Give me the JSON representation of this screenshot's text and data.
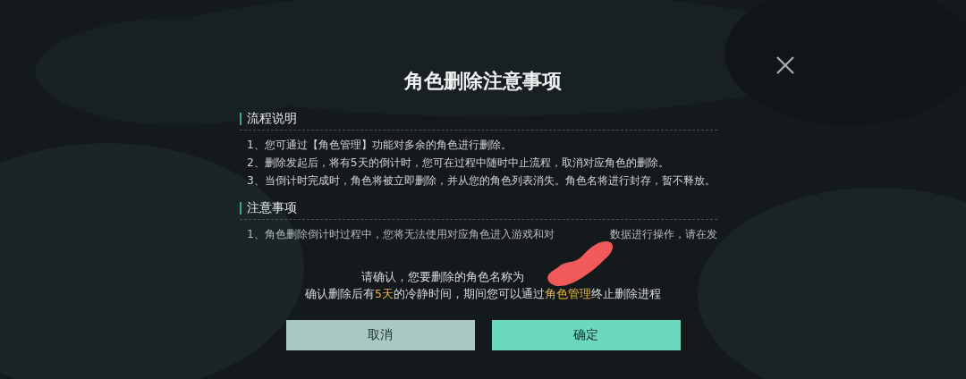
{
  "dialog": {
    "title": "角色删除注意事项",
    "sections": [
      {
        "heading": "流程说明",
        "lines": [
          "1、您可通过【角色管理】功能对多余的角色进行删除。",
          "2、删除发起后，将有5天的倒计时，您可在过程中随时中止流程，取消对应角色的删除。",
          "3、当倒计时完成时，角色将被立即删除，并从您的角色列表消失。角色名将进行封存，暂不释放。"
        ]
      },
      {
        "heading": "注意事项",
        "lines": [
          "1、角色删除倒计时过程中，您将无法使用对应角色进入游戏和对",
          "数据进行操作，请在发"
        ]
      }
    ],
    "confirm_prompt": "请确认，您要删除的角色名称为",
    "cooldown_notice": [
      {
        "text": "确认删除后有",
        "highlight": false
      },
      {
        "text": "5天",
        "highlight": true
      },
      {
        "text": "的冷静时间，期间您可以通过",
        "highlight": false
      },
      {
        "text": "角色管理",
        "highlight": true
      },
      {
        "text": "终止删除进程",
        "highlight": false
      }
    ],
    "buttons": [
      {
        "label": "取消",
        "kind": "secondary"
      },
      {
        "label": "确定",
        "kind": "primary"
      }
    ]
  }
}
